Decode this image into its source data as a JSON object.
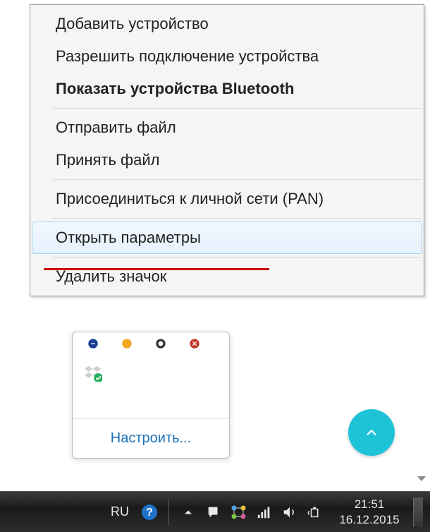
{
  "context_menu": {
    "items": [
      {
        "label": "Добавить устройство",
        "bold": false,
        "hover": false
      },
      {
        "label": "Разрешить подключение устройства",
        "bold": false,
        "hover": false
      },
      {
        "label": "Показать устройства Bluetooth",
        "bold": true,
        "hover": false
      }
    ],
    "items2": [
      {
        "label": "Отправить файл",
        "bold": false,
        "hover": false
      },
      {
        "label": "Принять файл",
        "bold": false,
        "hover": false
      }
    ],
    "items3": [
      {
        "label": "Присоединиться к личной сети (PAN)",
        "bold": false,
        "hover": false
      }
    ],
    "items4": [
      {
        "label": "Открыть параметры",
        "bold": false,
        "hover": true
      }
    ],
    "items5": [
      {
        "label": "Удалить значок",
        "bold": false,
        "hover": false
      }
    ]
  },
  "tray_popup": {
    "configure_label": "Настроить..."
  },
  "taskbar": {
    "language": "RU",
    "time": "21:51",
    "date": "16.12.2015"
  }
}
